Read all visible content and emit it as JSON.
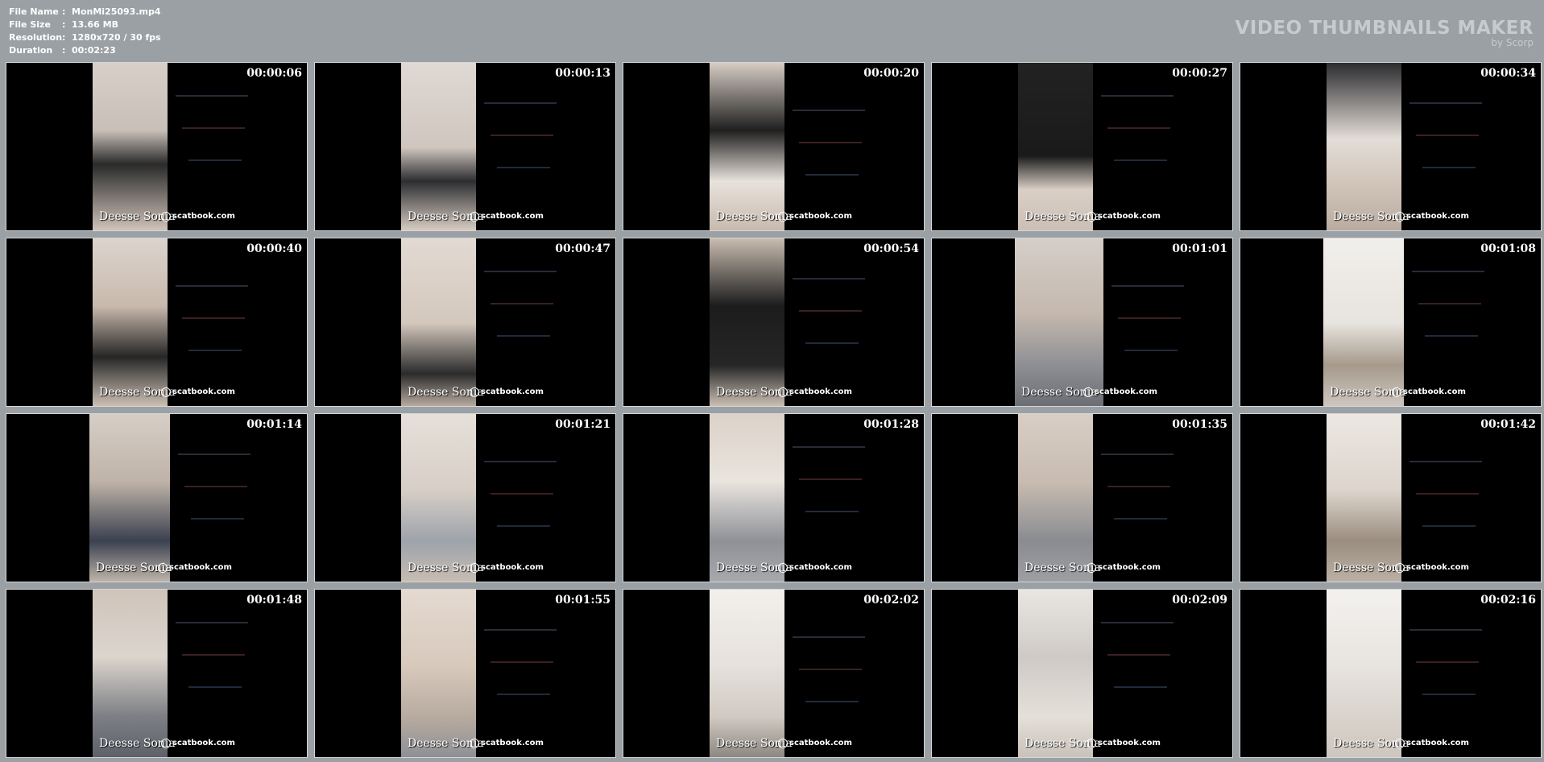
{
  "info": {
    "file_name_label": "File Name",
    "file_name": "MonMi25093.mp4",
    "file_size_label": "File Size",
    "file_size": "13.66 MB",
    "resolution_label": "Resolution",
    "resolution": "1280x720 / 30 fps",
    "duration_label": "Duration",
    "duration": "00:02:23",
    "separator": ":"
  },
  "brand": {
    "title": "VIDEO THUMBNAILS MAKER",
    "subtitle": "by Scorp"
  },
  "watermark": {
    "name": "Deesse Sonia",
    "site": "scatbook.com"
  },
  "thumbnails": [
    {
      "time": "00:00:06"
    },
    {
      "time": "00:00:13"
    },
    {
      "time": "00:00:20"
    },
    {
      "time": "00:00:27"
    },
    {
      "time": "00:00:34"
    },
    {
      "time": "00:00:40"
    },
    {
      "time": "00:00:47"
    },
    {
      "time": "00:00:54"
    },
    {
      "time": "00:01:01"
    },
    {
      "time": "00:01:08"
    },
    {
      "time": "00:01:14"
    },
    {
      "time": "00:01:21"
    },
    {
      "time": "00:01:28"
    },
    {
      "time": "00:01:35"
    },
    {
      "time": "00:01:42"
    },
    {
      "time": "00:01:48"
    },
    {
      "time": "00:01:55"
    },
    {
      "time": "00:02:02"
    },
    {
      "time": "00:02:09"
    },
    {
      "time": "00:02:16"
    }
  ]
}
